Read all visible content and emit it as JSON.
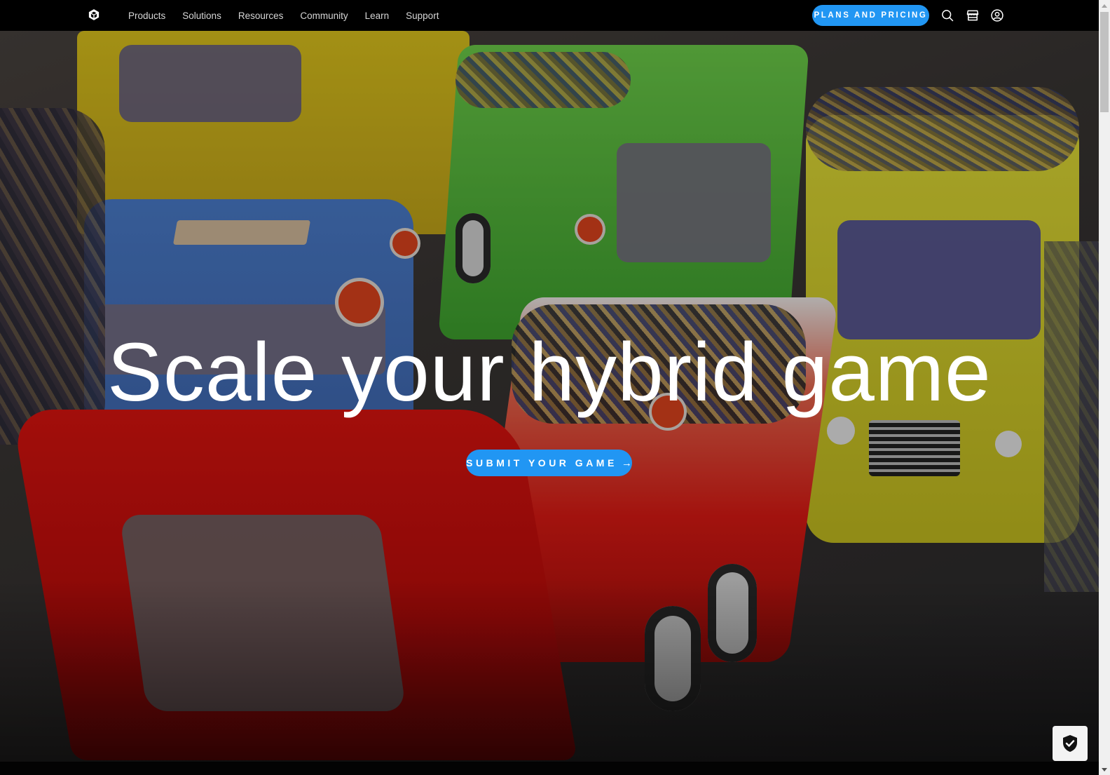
{
  "nav": {
    "logo": "unity-logo-icon",
    "links": [
      "Products",
      "Solutions",
      "Resources",
      "Community",
      "Learn",
      "Support"
    ],
    "cta_label": "PLANS AND PRICING",
    "icons": [
      "search-icon",
      "store-icon",
      "account-icon"
    ]
  },
  "hero": {
    "headline": "Scale your hybrid game",
    "cta_label": "SUBMIT YOUR GAME",
    "cta_arrow": "→",
    "background": "toy trucks game scene image"
  },
  "widgets": {
    "privacy_badge": "shield-check-icon"
  },
  "colors": {
    "accent": "#2196f3",
    "nav_bg": "#000000",
    "nav_text": "#d6d6d6",
    "headline": "#ffffff"
  }
}
